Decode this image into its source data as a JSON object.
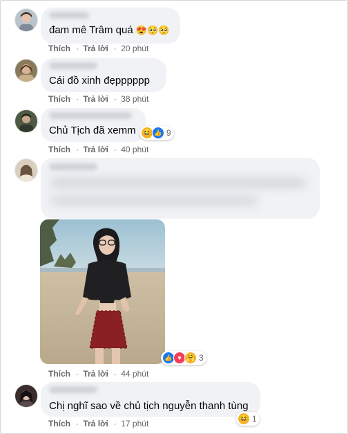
{
  "labels": {
    "like": "Thích",
    "reply": "Trả lời"
  },
  "comments": [
    {
      "text": "đam mê Trâm quá",
      "emojis": "😍🥺🥺",
      "time": "20 phút"
    },
    {
      "text": "Cái đồ xinh đẹpppppp",
      "time": "38 phút"
    },
    {
      "text": "Chủ Tịch đã xemm",
      "time": "40 phút",
      "reaction_count": "9",
      "reaction_icons": [
        "haha-icon",
        "like-icon"
      ]
    },
    {
      "time": "44 phút",
      "reaction_count": "3",
      "reaction_icons": [
        "like-icon",
        "love-icon",
        "care-icon"
      ]
    },
    {
      "text": "Chị nghĩ sao về chủ tịch nguyễn thanh tùng",
      "time": "17 phút",
      "reaction_count": "1",
      "reaction_icons": [
        "haha-icon"
      ]
    }
  ],
  "colors": {
    "bubble": "#f0f2f5",
    "meta": "#65676b",
    "like": "#1877f2",
    "love": "#f33e58",
    "haha": "#f7b125"
  }
}
